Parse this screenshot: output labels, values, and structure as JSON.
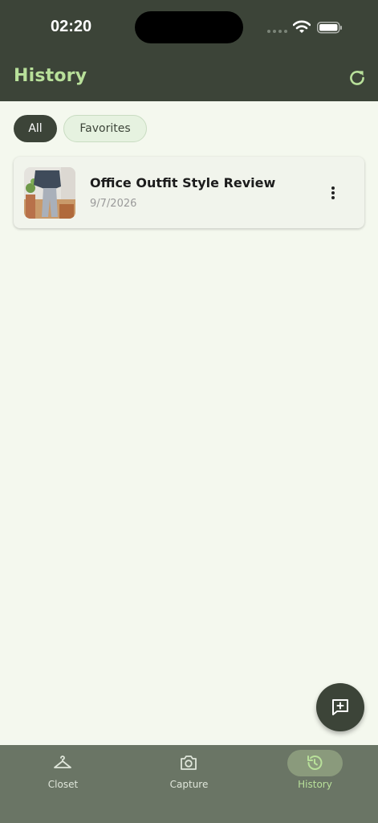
{
  "status_bar": {
    "time": "02:20"
  },
  "header": {
    "title": "History"
  },
  "filters": {
    "all_label": "All",
    "favorites_label": "Favorites",
    "selected": "All"
  },
  "history": {
    "items": [
      {
        "title": "Office Outfit Style Review",
        "date": "9/7/2026"
      }
    ]
  },
  "tabs": [
    {
      "label": "Closet",
      "icon": "hanger-icon"
    },
    {
      "label": "Capture",
      "icon": "camera-icon"
    },
    {
      "label": "History",
      "icon": "history-icon",
      "active": true
    }
  ],
  "colors": {
    "header_bg": "#3c4438",
    "accent": "#b8e09a",
    "page_bg": "#f4f8ee",
    "tabbar_bg": "#6a7565"
  }
}
